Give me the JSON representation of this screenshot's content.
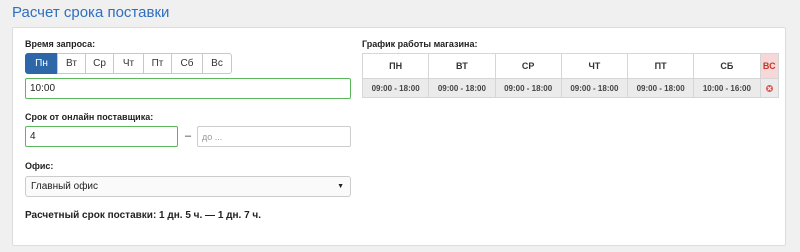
{
  "page": {
    "title": "Расчет срока поставки"
  },
  "request_time": {
    "label": "Время запроса:",
    "days": [
      {
        "label": "Пн",
        "active": true
      },
      {
        "label": "Вт",
        "active": false
      },
      {
        "label": "Ср",
        "active": false
      },
      {
        "label": "Чт",
        "active": false
      },
      {
        "label": "Пт",
        "active": false
      },
      {
        "label": "Сб",
        "active": false
      },
      {
        "label": "Вс",
        "active": false
      }
    ],
    "time_value": "10:00"
  },
  "supplier_term": {
    "label": "Срок от онлайн поставщика:",
    "from_value": "4",
    "separator": "–",
    "to_placeholder": "до ..."
  },
  "office": {
    "label": "Офис:",
    "selected": "Главный офис",
    "caret_icon": "caret-down-icon"
  },
  "estimate": {
    "text": "Расчетный срок поставки: 1 дн. 5 ч. — 1 дн. 7 ч."
  },
  "schedule": {
    "label": "График работы магазина:",
    "days": [
      "ПН",
      "ВТ",
      "СР",
      "ЧТ",
      "ПТ",
      "СБ",
      "ВС"
    ],
    "hours": [
      "09:00 - 18:00",
      "09:00 - 18:00",
      "09:00 - 18:00",
      "09:00 - 18:00",
      "09:00 - 18:00",
      "10:00 - 16:00",
      ""
    ],
    "closed_icon": "closed-icon",
    "colors": {
      "closed_bg": "#f6d8d8",
      "closed_text": "#c0392b",
      "accent": "#2e67a8",
      "valid_border": "#5cb85c"
    }
  }
}
